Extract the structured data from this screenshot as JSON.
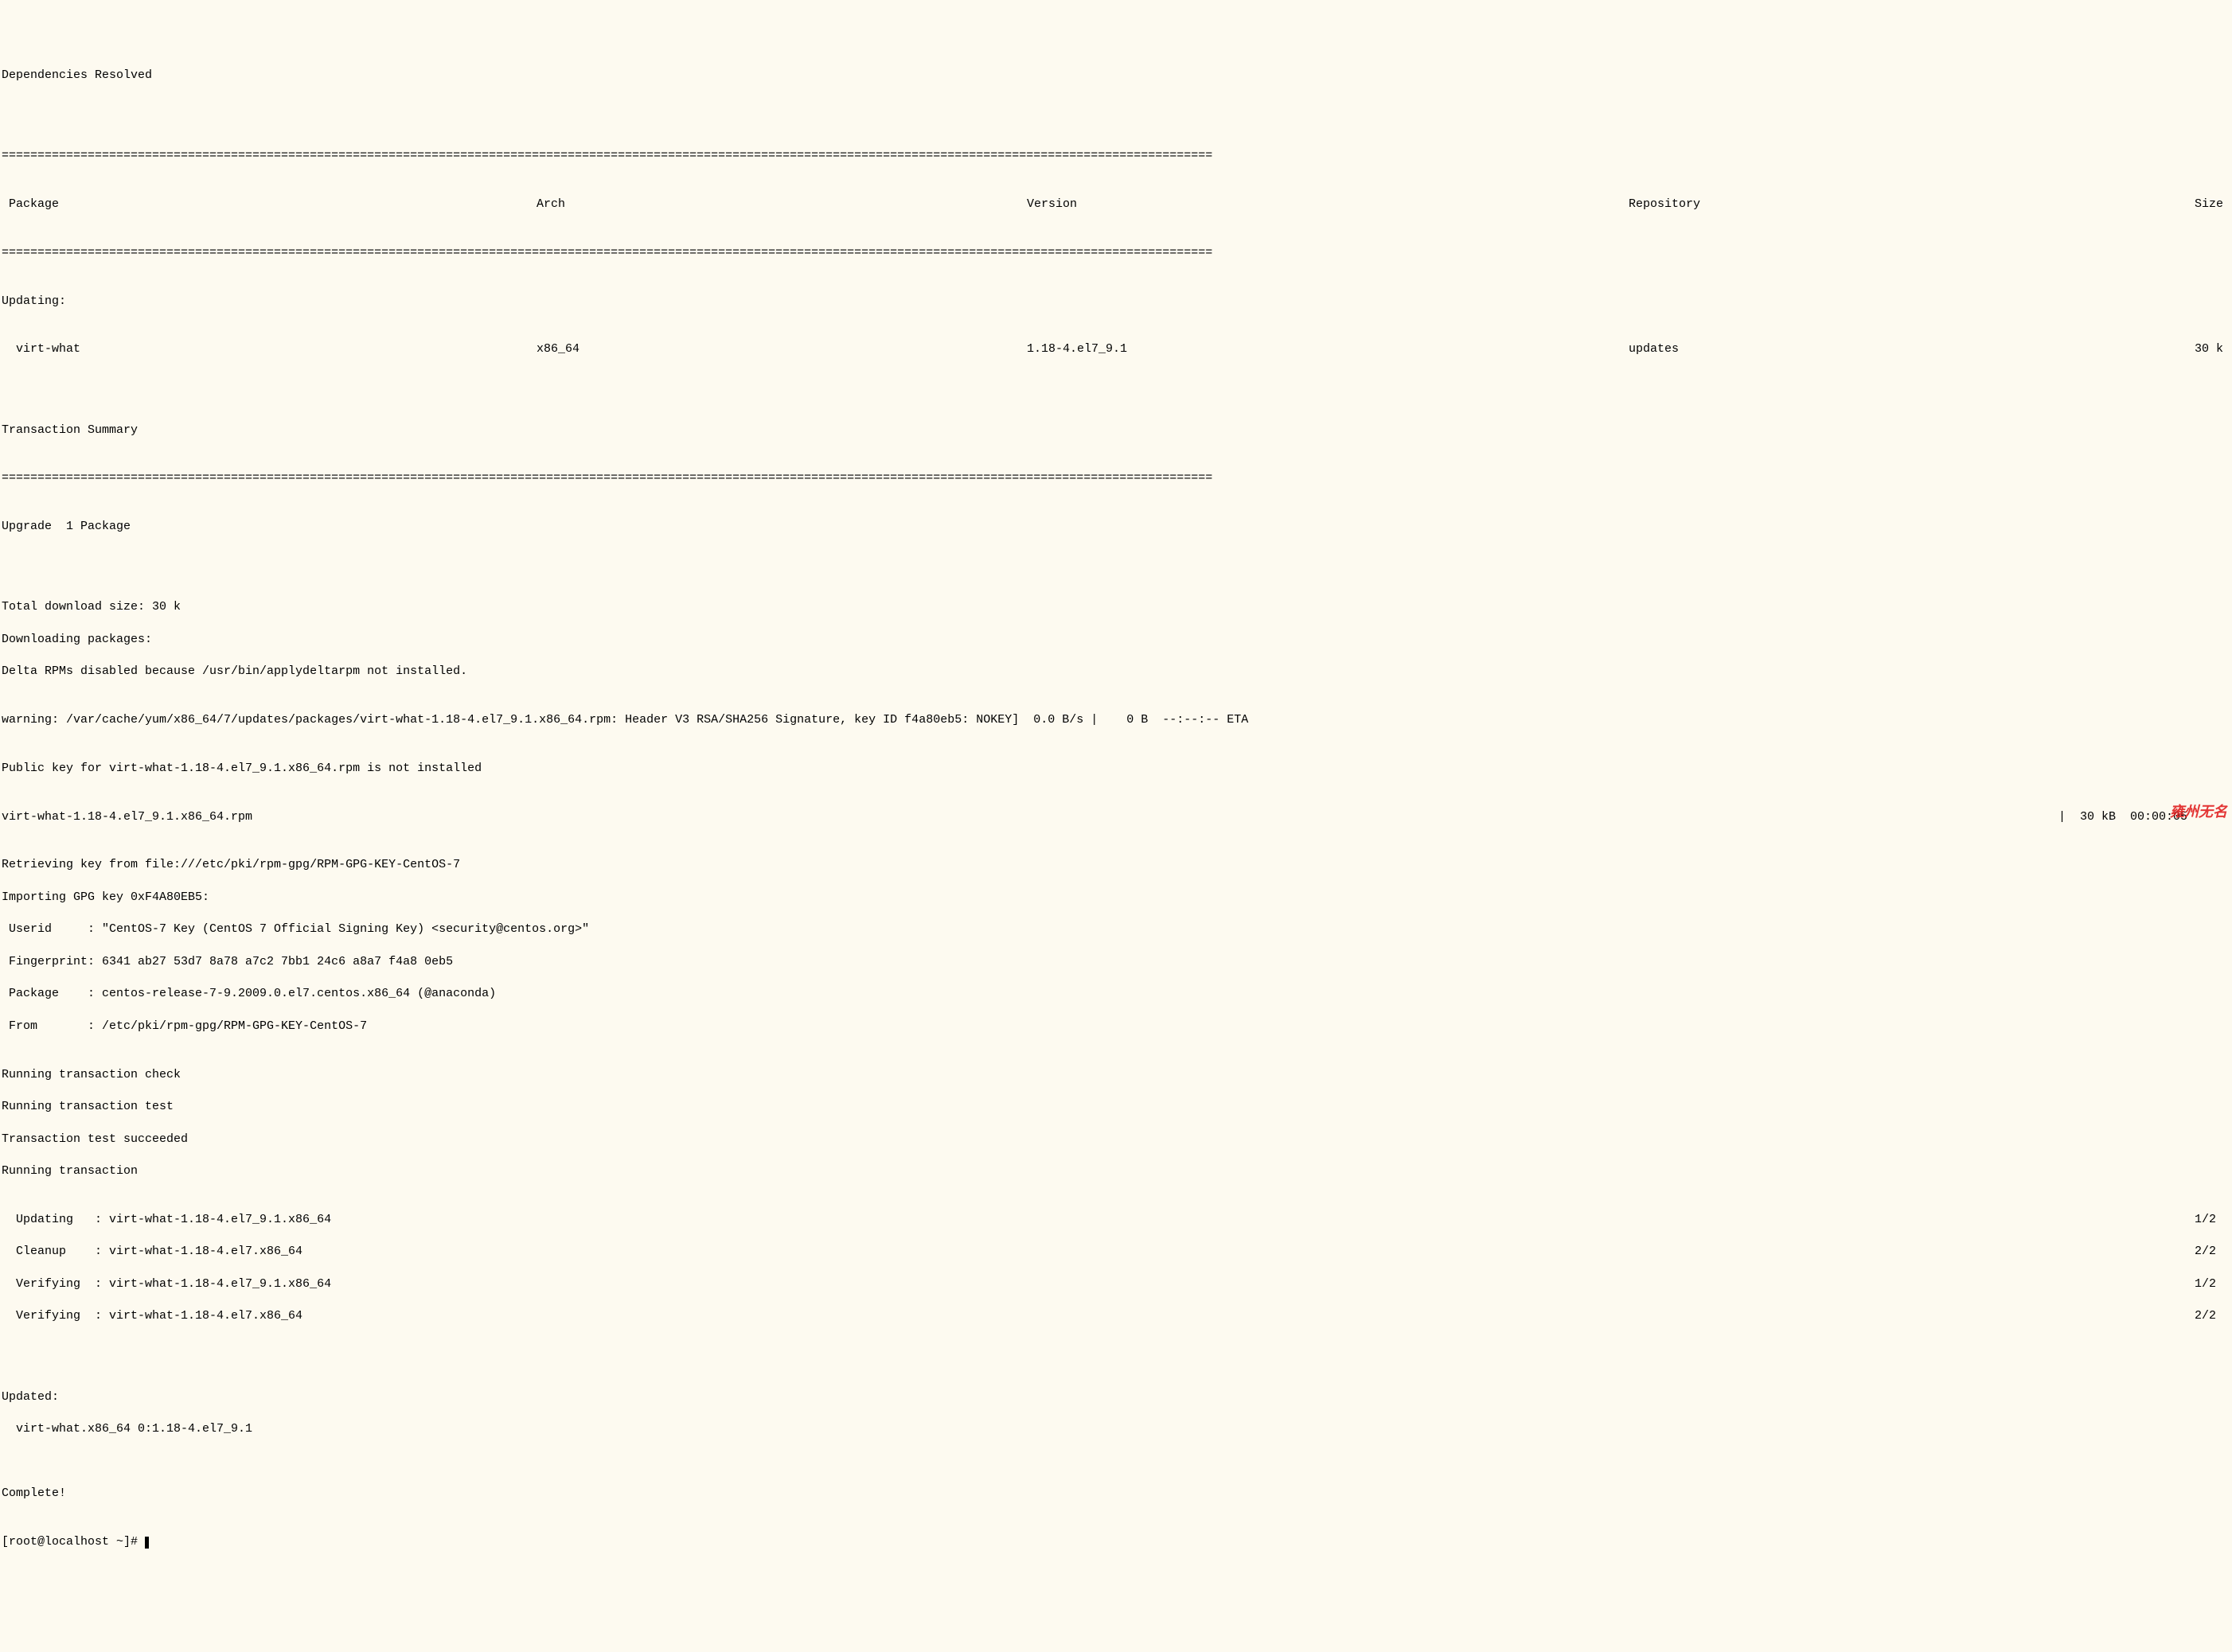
{
  "header": {
    "dependencies": "Dependencies Resolved"
  },
  "divider": "=========================================================================================================================================================================",
  "columns": {
    "package": "Package",
    "arch": "Arch",
    "version": "Version",
    "repository": "Repository",
    "size": "Size"
  },
  "updating_label": "Updating:",
  "package_row": {
    "name": " virt-what",
    "arch": "x86_64",
    "version": "1.18-4.el7_9.1",
    "repo": "updates",
    "size": "30 k"
  },
  "transaction_summary": "Transaction Summary",
  "upgrade_line": "Upgrade  1 Package",
  "download": {
    "total_size": "Total download size: 30 k",
    "downloading": "Downloading packages:",
    "delta_disabled": "Delta RPMs disabled because /usr/bin/applydeltarpm not installed.",
    "warning_left": "warning: /var/cache/yum/x86_64/7/updates/packages/virt-what-1.18-4.el7_9.1.x86_64.rpm: Header V3 RSA/SHA256 Signature, key ID f4a80eb5: NOKEY]  0.0 B/s |    0 B  --:--:-- ETA ",
    "pubkey": "Public key for virt-what-1.18-4.el7_9.1.x86_64.rpm is not installed",
    "rpm_line_left": "virt-what-1.18-4.el7_9.1.x86_64.rpm",
    "rpm_line_right": "|  30 kB  00:00:05     ",
    "retrieving": "Retrieving key from file:///etc/pki/rpm-gpg/RPM-GPG-KEY-CentOS-7",
    "importing": "Importing GPG key 0xF4A80EB5:",
    "userid": " Userid     : \"CentOS-7 Key (CentOS 7 Official Signing Key) <security@centos.org>\"",
    "fingerprint": " Fingerprint: 6341 ab27 53d7 8a78 a7c2 7bb1 24c6 a8a7 f4a8 0eb5",
    "package": " Package    : centos-release-7-9.2009.0.el7.centos.x86_64 (@anaconda)",
    "from": " From       : /etc/pki/rpm-gpg/RPM-GPG-KEY-CentOS-7"
  },
  "transaction": {
    "check": "Running transaction check",
    "test": "Running transaction test",
    "succeeded": "Transaction test succeeded",
    "running": "Running transaction"
  },
  "steps": [
    {
      "label": "  Updating   : virt-what-1.18-4.el7_9.1.x86_64",
      "progress": "1/2 "
    },
    {
      "label": "  Cleanup    : virt-what-1.18-4.el7.x86_64",
      "progress": "2/2 "
    },
    {
      "label": "  Verifying  : virt-what-1.18-4.el7_9.1.x86_64",
      "progress": "1/2 "
    },
    {
      "label": "  Verifying  : virt-what-1.18-4.el7.x86_64",
      "progress": "2/2 "
    }
  ],
  "updated": {
    "header": "Updated:",
    "item": "  virt-what.x86_64 0:1.18-4.el7_9.1"
  },
  "complete": "Complete!",
  "prompt": "[root@localhost ~]# ",
  "watermark": "雍州无名"
}
